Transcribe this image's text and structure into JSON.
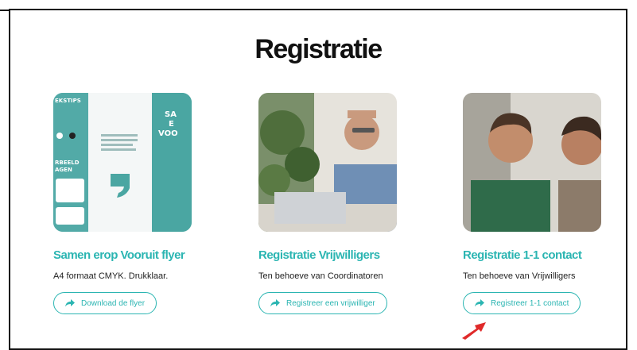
{
  "page": {
    "title": "Registratie"
  },
  "cards": [
    {
      "image_alt": "flyer-preview",
      "title": "Samen erop Vooruit flyer",
      "subtitle": "A4 formaat CMYK. Drukklaar.",
      "button_label": "Download de flyer",
      "button_icon": "share-arrow-icon"
    },
    {
      "image_alt": "man-at-laptop-photo",
      "title": "Registratie Vrijwilligers",
      "subtitle": "Ten behoeve van Coordinatoren",
      "button_label": "Registreer een vrijwilliger",
      "button_icon": "share-arrow-icon"
    },
    {
      "image_alt": "two-men-talking-photo",
      "title": "Registratie 1-1 contact",
      "subtitle": "Ten behoeve van Vrijwilligers",
      "button_label": "Registreer 1-1 contact",
      "button_icon": "share-arrow-icon"
    }
  ],
  "colors": {
    "accent": "#2bb5b2",
    "text": "#222222",
    "cursor": "#e02a2a"
  }
}
